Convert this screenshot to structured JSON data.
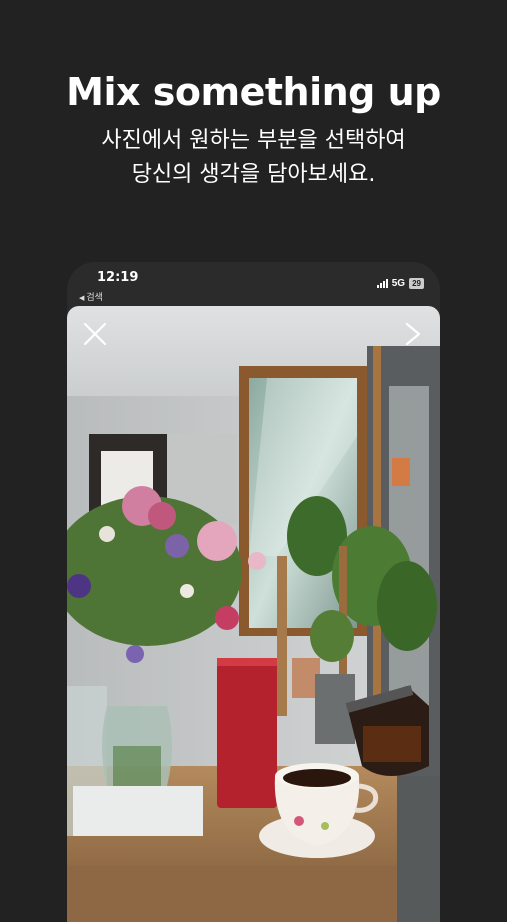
{
  "headline": "Mix something up",
  "subtitle": {
    "line1": "사진에서 원하는 부분을 선택하여",
    "line2": "당신의 생각을 담아보세요."
  },
  "phone": {
    "status_bar": {
      "time": "12:19",
      "back_label": "검색",
      "network": "5G",
      "battery": "29"
    },
    "editor": {
      "close_icon": "close-icon",
      "next_icon": "chevron-right-icon"
    }
  },
  "colors": {
    "background": "#222222",
    "text": "#ffffff"
  }
}
